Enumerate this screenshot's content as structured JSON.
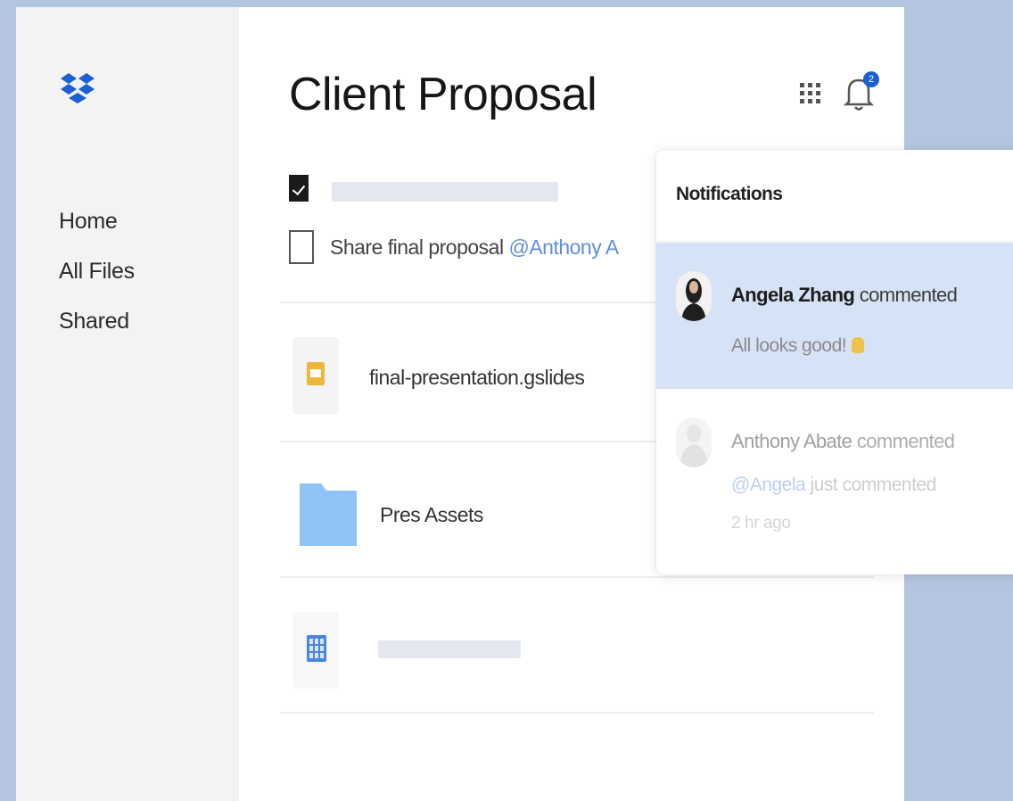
{
  "app": {
    "brand": "Dropbox",
    "logo_icon": "dropbox-logo-icon"
  },
  "sidebar": {
    "items": [
      {
        "label": "Home"
      },
      {
        "label": "All Files"
      },
      {
        "label": "Shared"
      }
    ]
  },
  "header": {
    "title": "Client Proposal",
    "apps_icon": "grid-apps-icon",
    "bell_icon": "bell-icon",
    "notification_count": "2"
  },
  "tasks": [
    {
      "checked": true,
      "label": ""
    },
    {
      "checked": false,
      "label": "Share final proposal ",
      "mention": "@Anthony A"
    }
  ],
  "files": [
    {
      "name": "final-presentation.gslides",
      "icon": "slides-icon"
    },
    {
      "name": "Pres Assets",
      "icon": "folder-icon"
    },
    {
      "name": "",
      "icon": "spreadsheet-icon"
    }
  ],
  "notifications": {
    "title": "Notifications",
    "items": [
      {
        "user": "Angela Zhang",
        "action": " commented",
        "message": "All looks good!",
        "emoji_icon": "thumbs-up-icon",
        "active": true
      },
      {
        "user": "Anthony Abate",
        "action": " commented",
        "mention": "@Angela",
        "message": " just commented",
        "time": "2 hr ago"
      }
    ]
  },
  "colors": {
    "background": "#b4c5df",
    "brand_blue": "#1a5fd3",
    "folder_blue": "#90c2f5",
    "highlight": "#d6e2f6",
    "mention": "#5d8fdf"
  }
}
